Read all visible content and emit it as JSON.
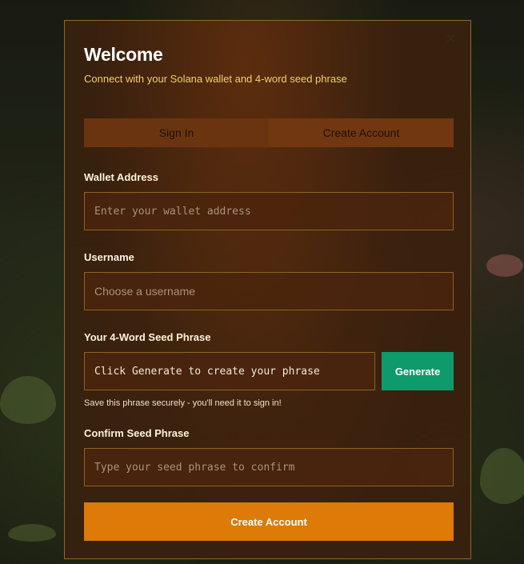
{
  "modal": {
    "title": "Welcome",
    "subtitle": "Connect with your Solana wallet and 4-word seed phrase",
    "close_icon": "close-icon"
  },
  "tabs": [
    {
      "label": "Sign In",
      "active": false
    },
    {
      "label": "Create Account",
      "active": true
    }
  ],
  "form": {
    "wallet": {
      "label": "Wallet Address",
      "placeholder": "Enter your wallet address",
      "value": ""
    },
    "username": {
      "label": "Username",
      "placeholder": "Choose a username",
      "value": ""
    },
    "seed": {
      "label": "Your 4-Word Seed Phrase",
      "display": "Click Generate to create your phrase",
      "generate_label": "Generate",
      "hint": "Save this phrase securely - you'll need it to sign in!"
    },
    "confirm": {
      "label": "Confirm Seed Phrase",
      "placeholder": "Type your seed phrase to confirm",
      "value": ""
    },
    "submit_label": "Create Account"
  },
  "colors": {
    "accent": "#dd7a08",
    "generate": "#0f9a6b",
    "subtitle": "#f2cf6a",
    "modal_border": "#8a6a2a"
  }
}
